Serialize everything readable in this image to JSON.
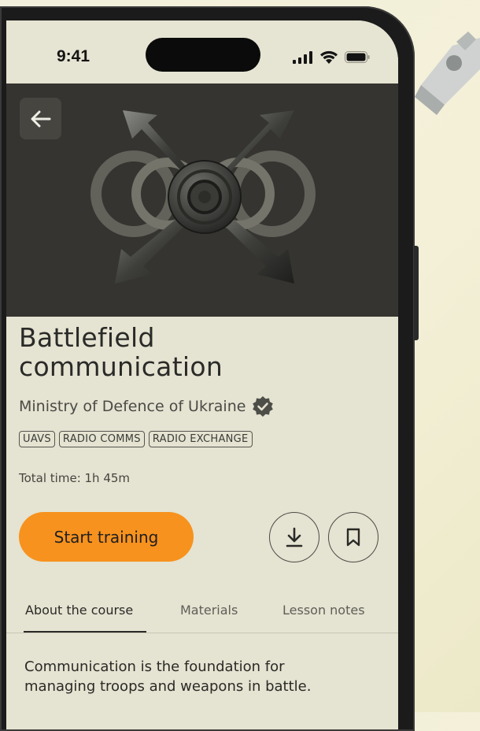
{
  "status_bar": {
    "time": "9:41",
    "signal_icon": "cellular-signal-icon",
    "wifi_icon": "wifi-icon",
    "battery_icon": "battery-icon"
  },
  "hero": {
    "back_icon": "arrow-left-icon",
    "illustration": "crossed-lightning-arrows-emblem"
  },
  "course": {
    "title_line1": "Battlefield",
    "title_line2": "communication",
    "publisher": "Ministry of Defence of Ukraine",
    "verified_icon": "verified-badge-icon",
    "tags": [
      "UAVS",
      "RADIO COMMS",
      "RADIO EXCHANGE"
    ],
    "total_time": "Total time: 1h 45m"
  },
  "actions": {
    "start_label": "Start training",
    "download_icon": "download-icon",
    "bookmark_icon": "bookmark-icon"
  },
  "tabs": [
    {
      "label": "About the course",
      "active": true
    },
    {
      "label": "Materials",
      "active": false
    },
    {
      "label": "Lesson notes",
      "active": false
    }
  ],
  "description": {
    "line1": "Communication is the foundation for",
    "line2": "managing troops and weapons in battle."
  },
  "colors": {
    "accent": "#f7921e",
    "hero_bg": "#353430",
    "screen_bg": "#e5e3d1"
  }
}
